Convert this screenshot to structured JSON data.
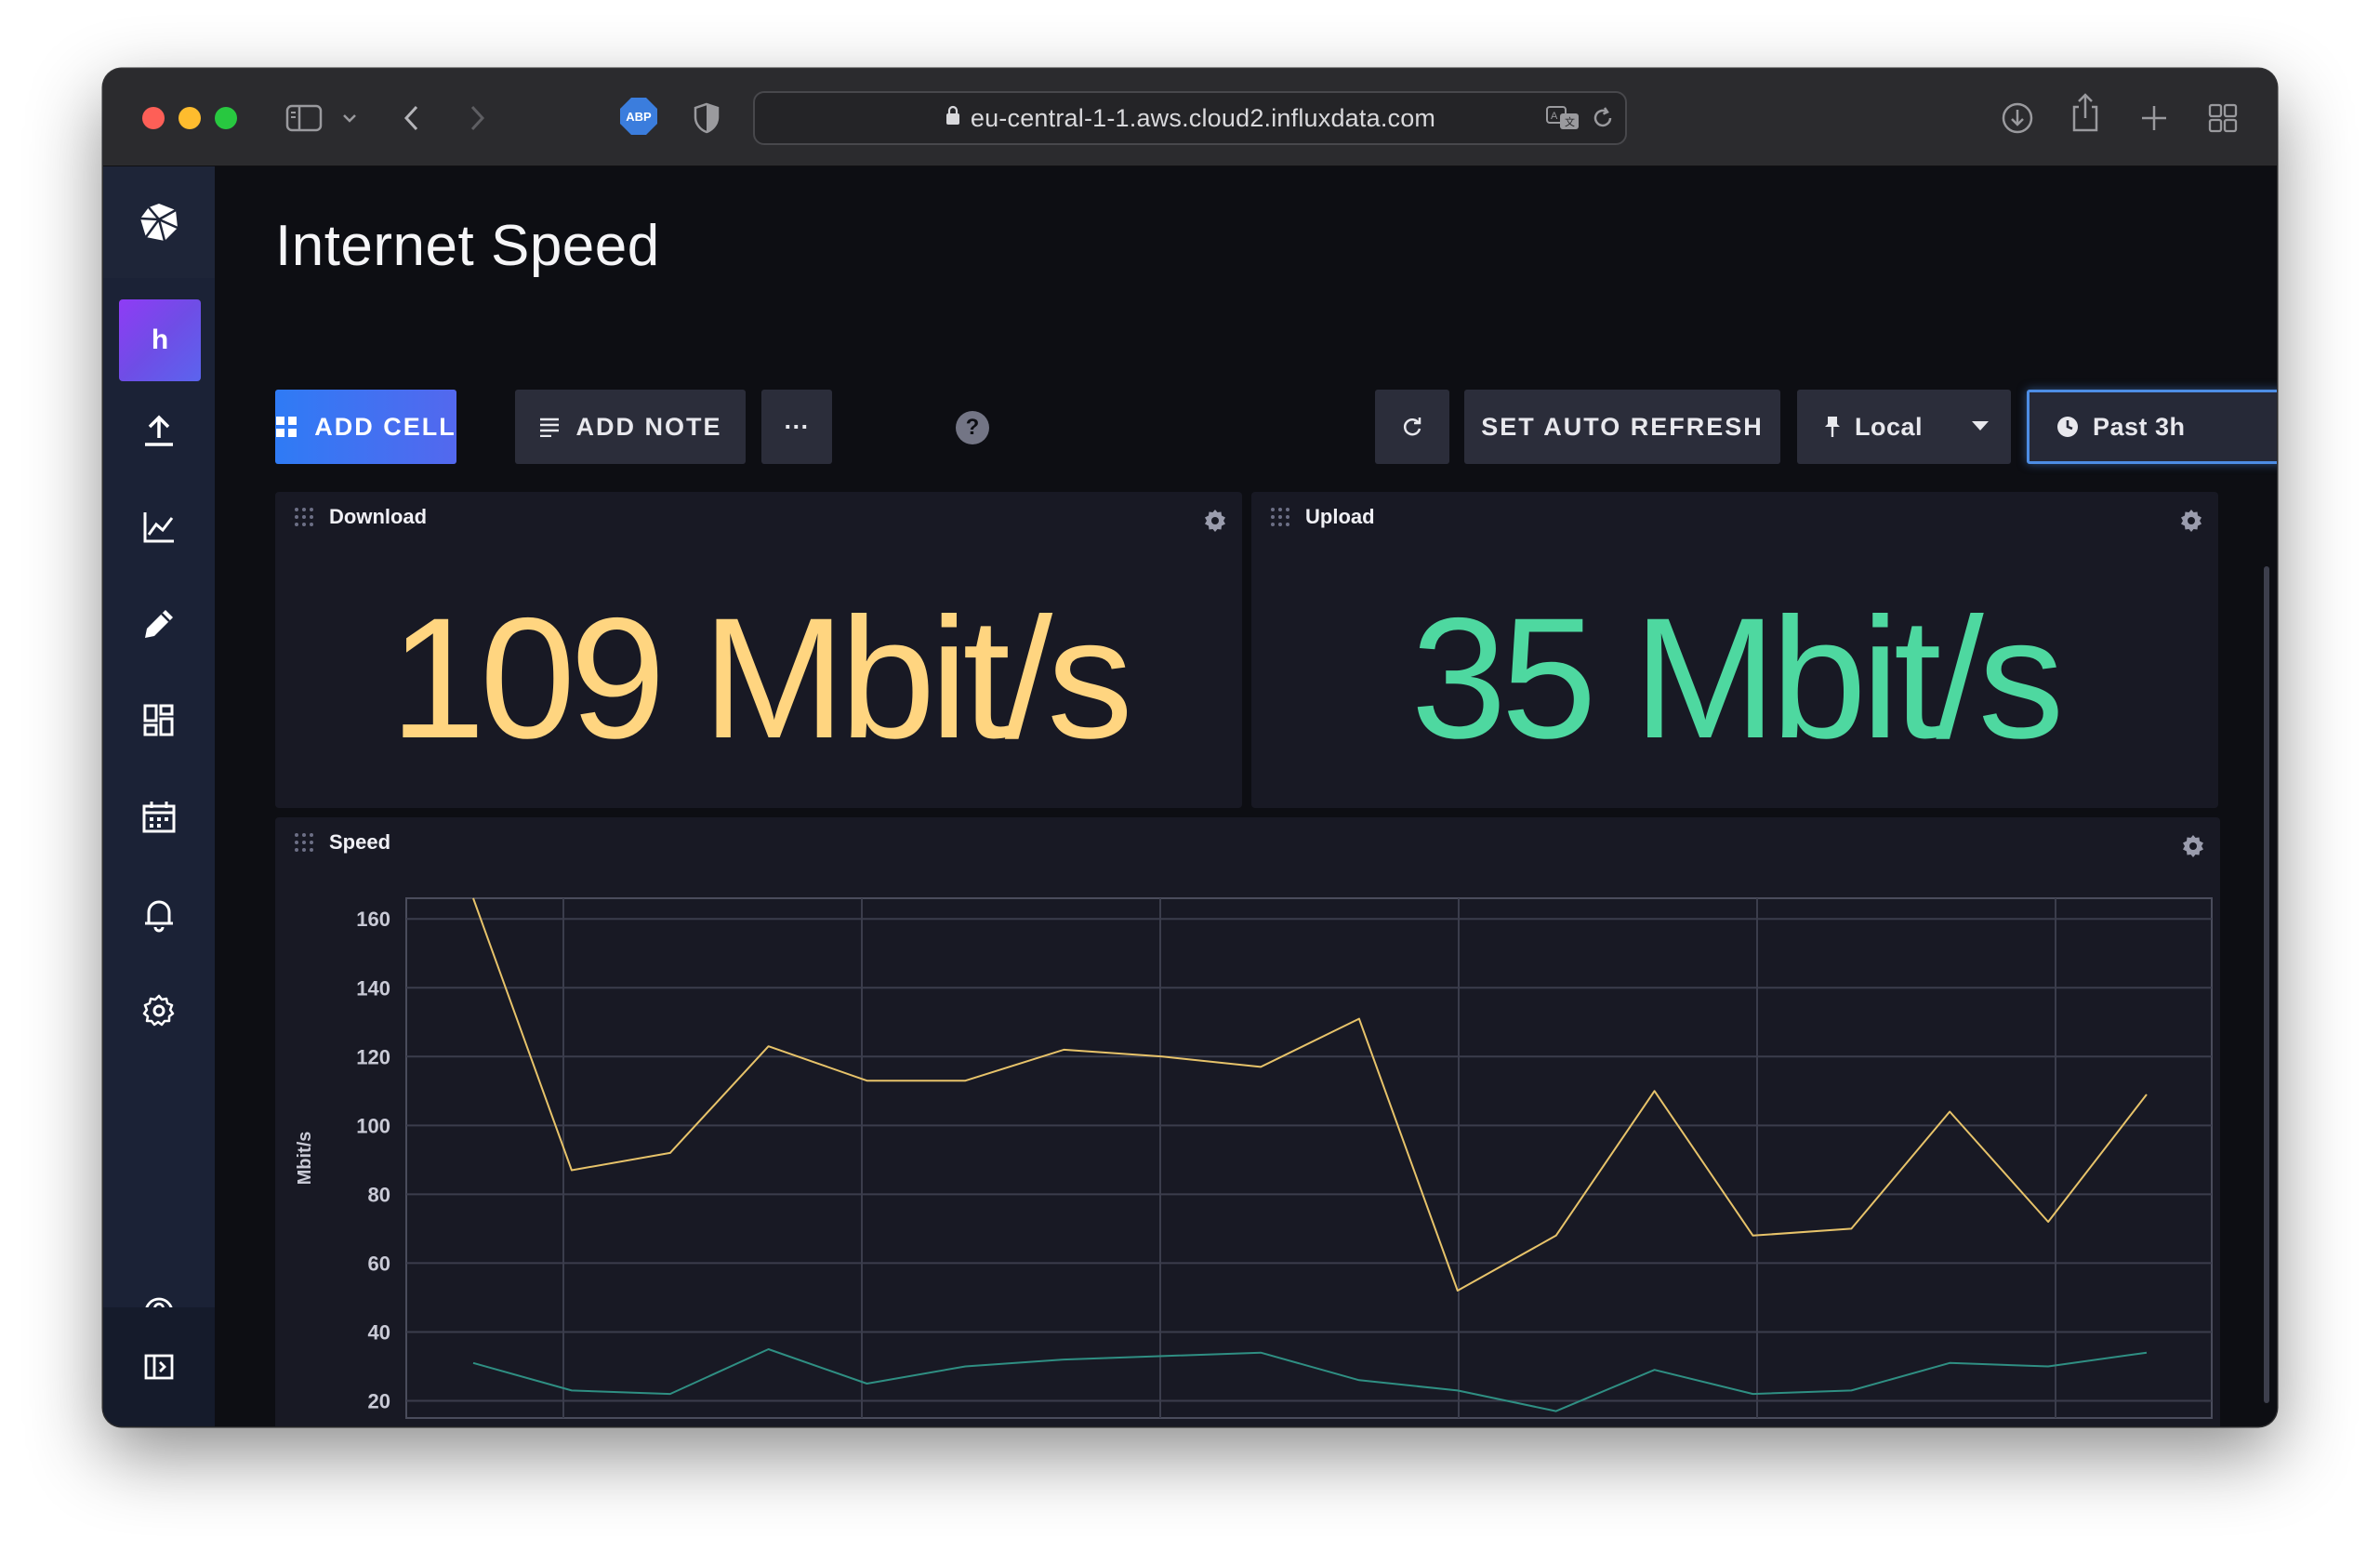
{
  "browser": {
    "url": "eu-central-1-1.aws.cloud2.influxdata.com",
    "abp_label": "ABP"
  },
  "sidebar": {
    "org_initial": "h"
  },
  "page": {
    "title": "Internet Speed"
  },
  "toolbar": {
    "add_cell": "ADD CELL",
    "add_note": "ADD NOTE",
    "more": "···",
    "help": "?",
    "auto_refresh": "SET AUTO REFRESH",
    "timezone": "Local",
    "time_range": "Past 3h"
  },
  "cells": {
    "download": {
      "title": "Download",
      "value": "109 Mbit/s",
      "color": "#ffd580"
    },
    "upload": {
      "title": "Upload",
      "value": "35 Mbit/s",
      "color": "#4ed8a0"
    },
    "speed": {
      "title": "Speed"
    }
  },
  "colors": {
    "download_line": "#e7c36a",
    "upload_line": "#2f8f83",
    "primary_button": "#2f7bf5"
  },
  "chart_data": {
    "type": "line",
    "title": "Speed",
    "ylabel": "Mbit/s",
    "xlabel": "",
    "ylim": [
      15,
      166
    ],
    "yticks": [
      20,
      40,
      60,
      80,
      100,
      120,
      140,
      160
    ],
    "grid": true,
    "series": [
      {
        "name": "",
        "color": "#e7c36a",
        "values": [
          166,
          87,
          92,
          123,
          113,
          113,
          122,
          120,
          117,
          131,
          52,
          68,
          110,
          68,
          70,
          104,
          72,
          109
        ]
      },
      {
        "name": "",
        "color": "#2f8f83",
        "values": [
          31,
          23,
          22,
          35,
          25,
          30,
          32,
          33,
          34,
          26,
          23,
          17,
          29,
          22,
          23,
          31,
          30,
          34
        ]
      }
    ]
  }
}
